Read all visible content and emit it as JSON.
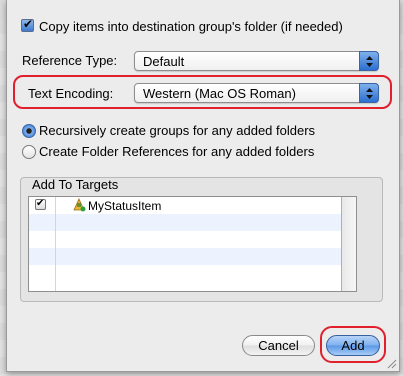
{
  "dialog": {
    "copy_items_label": "Copy items into destination group's folder (if needed)",
    "copy_items_checked": true,
    "reference_type_label": "Reference Type:",
    "reference_type_value": "Default",
    "text_encoding_label": "Text Encoding:",
    "text_encoding_value": "Western (Mac OS Roman)",
    "radio_recursive_label": "Recursively create groups for any added folders",
    "radio_folder_refs_label": "Create Folder References for any added folders",
    "targets_title": "Add To Targets",
    "targets": [
      {
        "name": "MyStatusItem",
        "checked": true
      }
    ],
    "cancel_label": "Cancel",
    "add_label": "Add"
  },
  "colors": {
    "highlight": "#e0202c",
    "accent_blue": "#2c6fd0"
  }
}
